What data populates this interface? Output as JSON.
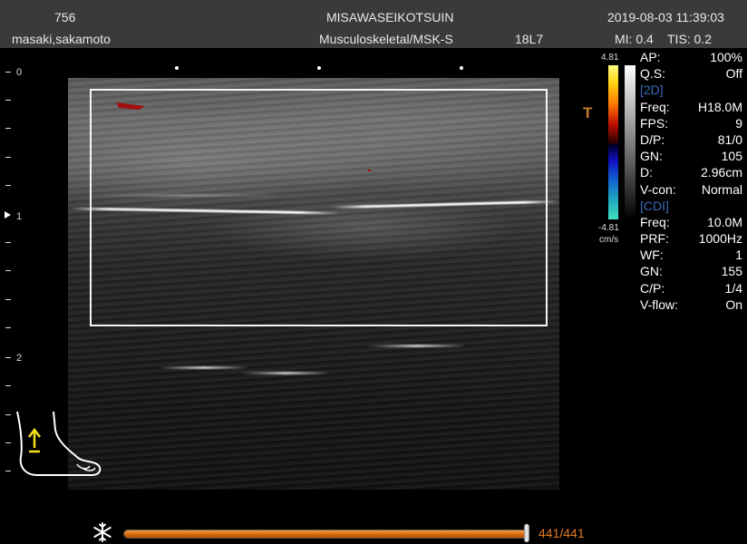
{
  "header": {
    "id_number": "756",
    "facility": "MISAWASEIKOTSUIN",
    "datetime": "2019-08-03 11:39:03",
    "patient_name": "masaki,sakamoto",
    "preset": "Musculoskeletal/MSK-S",
    "probe": "18L7",
    "mi": "MI: 0.4",
    "tis": "TIS: 0.2"
  },
  "depth_scale": {
    "labels": [
      "0",
      "1",
      "2"
    ]
  },
  "color_scale": {
    "max": "4.81",
    "min": "-4.81",
    "unit": "cm/s"
  },
  "marker": "T",
  "params": {
    "ap": {
      "label": "AP:",
      "value": "100%"
    },
    "qs": {
      "label": "Q.S:",
      "value": "Off"
    },
    "section_2d": "[2D]",
    "freq_2d": {
      "label": "Freq:",
      "value": "H18.0M"
    },
    "fps": {
      "label": "FPS:",
      "value": "9"
    },
    "dp": {
      "label": "D/P:",
      "value": "81/0"
    },
    "gn_2d": {
      "label": "GN:",
      "value": "105"
    },
    "depth": {
      "label": "D:",
      "value": "2.96cm"
    },
    "vcon": {
      "label": "V-con:",
      "value": "Normal"
    },
    "section_cdi": "[CDI]",
    "freq_cdi": {
      "label": "Freq:",
      "value": "10.0M"
    },
    "prf": {
      "label": "PRF:",
      "value": "1000Hz"
    },
    "wf": {
      "label": "WF:",
      "value": "1"
    },
    "gn_cdi": {
      "label": "GN:",
      "value": "155"
    },
    "cp": {
      "label": "C/P:",
      "value": "1/4"
    },
    "vflow": {
      "label": "V-flow:",
      "value": "On"
    }
  },
  "cine": {
    "frame_label": "441/441",
    "progress": 1.0
  },
  "icons": {
    "body_mark": "foot-body-mark-icon",
    "freeze": "snowflake-icon"
  },
  "colors": {
    "accent_orange": "#e07a20",
    "section_blue": "#3a6ab8",
    "header_bg": "#3a3a3a"
  }
}
